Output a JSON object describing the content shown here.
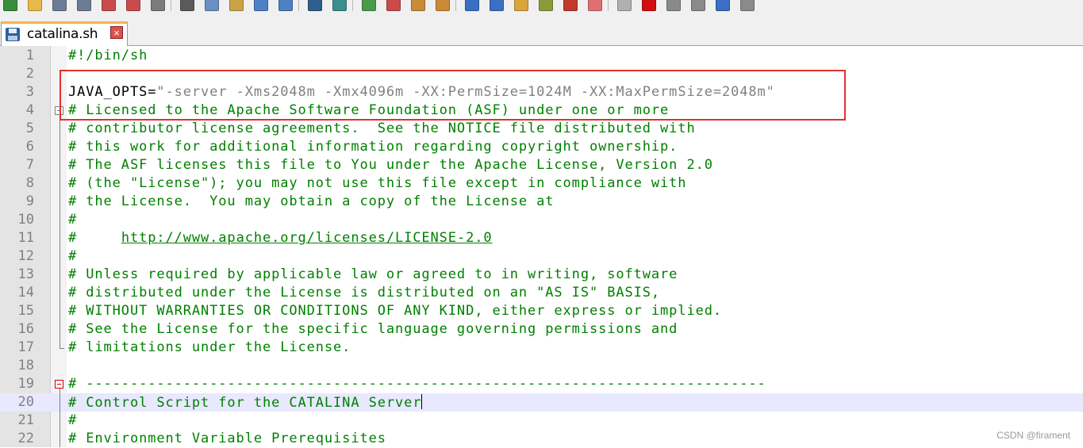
{
  "toolbar": {
    "icons": [
      "new-file",
      "open-file",
      "save",
      "save-all",
      "close",
      "close-all",
      "print",
      "cut",
      "copy",
      "paste",
      "undo",
      "redo",
      "find",
      "replace",
      "zoom-in",
      "zoom-out",
      "sync-vertical",
      "sync-horizontal",
      "word-wrap",
      "all-chars",
      "indent-guide",
      "udl",
      "doc-map",
      "function-list",
      "monitoring",
      "record-macro",
      "stop-record",
      "play-macro",
      "run-macro-multiple",
      "save-macro"
    ]
  },
  "tab": {
    "filename": "catalina.sh",
    "close_glyph": "×"
  },
  "editor": {
    "current_line": 20,
    "lines": [
      {
        "num": "1",
        "text": "#!/bin/sh",
        "kind": "comment"
      },
      {
        "num": "2",
        "text": "",
        "kind": "plain"
      },
      {
        "num": "3",
        "prefix": "JAVA_OPTS=",
        "text": "\"-server -Xms2048m -Xmx4096m -XX:PermSize=1024M -XX:MaxPermSize=2048m\"",
        "kind": "assign"
      },
      {
        "num": "4",
        "text": "# Licensed to the Apache Software Foundation (ASF) under one or more",
        "kind": "comment"
      },
      {
        "num": "5",
        "text": "# contributor license agreements.  See the NOTICE file distributed with",
        "kind": "comment"
      },
      {
        "num": "6",
        "text": "# this work for additional information regarding copyright ownership.",
        "kind": "comment"
      },
      {
        "num": "7",
        "text": "# The ASF licenses this file to You under the Apache License, Version 2.0",
        "kind": "comment"
      },
      {
        "num": "8",
        "text": "# (the \"License\"); you may not use this file except in compliance with",
        "kind": "comment"
      },
      {
        "num": "9",
        "text": "# the License.  You may obtain a copy of the License at",
        "kind": "comment"
      },
      {
        "num": "10",
        "text": "#",
        "kind": "comment"
      },
      {
        "num": "11",
        "prefix": "#     ",
        "text": "http://www.apache.org/licenses/LICENSE-2.0",
        "kind": "link"
      },
      {
        "num": "12",
        "text": "#",
        "kind": "comment"
      },
      {
        "num": "13",
        "text": "# Unless required by applicable law or agreed to in writing, software",
        "kind": "comment"
      },
      {
        "num": "14",
        "text": "# distributed under the License is distributed on an \"AS IS\" BASIS,",
        "kind": "comment"
      },
      {
        "num": "15",
        "text": "# WITHOUT WARRANTIES OR CONDITIONS OF ANY KIND, either express or implied.",
        "kind": "comment"
      },
      {
        "num": "16",
        "text": "# See the License for the specific language governing permissions and",
        "kind": "comment"
      },
      {
        "num": "17",
        "text": "# limitations under the License.",
        "kind": "comment"
      },
      {
        "num": "18",
        "text": "",
        "kind": "plain"
      },
      {
        "num": "19",
        "text": "# -----------------------------------------------------------------------------",
        "kind": "comment"
      },
      {
        "num": "20",
        "text": "# Control Script for the CATALINA Server",
        "kind": "comment"
      },
      {
        "num": "21",
        "text": "#",
        "kind": "comment"
      },
      {
        "num": "22",
        "text": "# Environment Variable Prerequisites",
        "kind": "comment"
      }
    ]
  },
  "colors": {
    "comment": "#008000",
    "string": "#808080",
    "highlight_border": "#e03030",
    "current_line_bg": "#e8e8ff"
  },
  "watermark": "CSDN @firament"
}
